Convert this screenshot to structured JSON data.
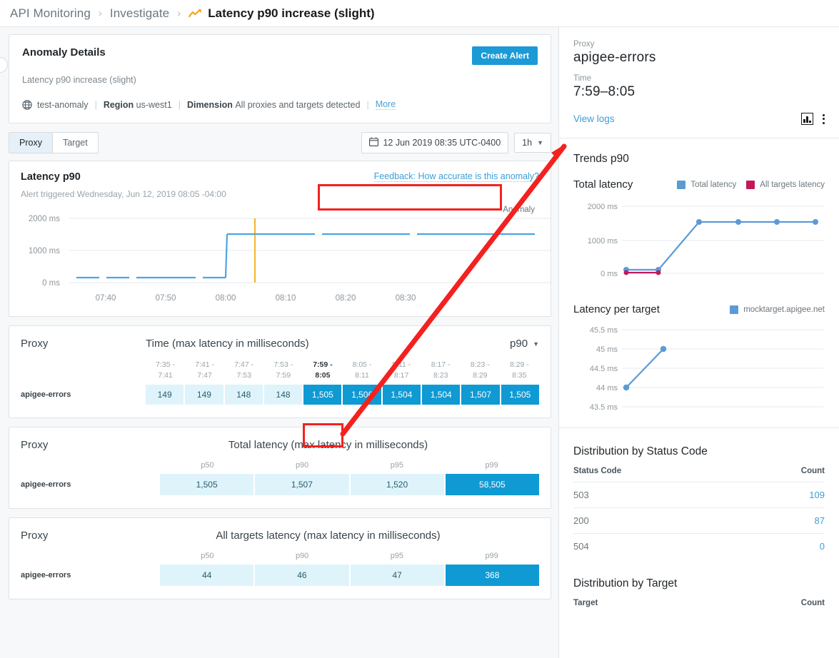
{
  "breadcrumb": {
    "root": "API Monitoring",
    "section": "Investigate",
    "icon": "trending-up-icon",
    "current": "Latency p90 increase (slight)",
    "separator": "›"
  },
  "anomaly": {
    "title": "Anomaly Details",
    "create_alert_label": "Create Alert",
    "subtitle": "Latency p90 increase (slight)",
    "env_name": "test-anomaly",
    "region_label": "Region",
    "region_value": "us-west1",
    "dimension_label": "Dimension",
    "dimension_value": "All proxies and targets detected",
    "more_label": "More",
    "separator": "|"
  },
  "toolbar": {
    "tabs": [
      {
        "label": "Proxy",
        "active": true
      },
      {
        "label": "Target",
        "active": false
      }
    ],
    "date_value": "12 Jun 2019 08:35 UTC-0400",
    "range_value": "1h",
    "calendar_icon": "calendar-icon",
    "caret_icon": "chevron-down-icon"
  },
  "latency_chart": {
    "title": "Latency p90",
    "feedback_label": "Feedback: How accurate is this anomaly?",
    "alert_text": "Alert triggered Wednesday, Jun 12, 2019 08:05 -04:00",
    "legend_label": "Anomaly"
  },
  "proxy_time_table": {
    "col_label": "Proxy",
    "title": "Time (max latency in milliseconds)",
    "percentile_label": "p90",
    "row_label": "apigee-errors",
    "buckets": [
      {
        "from": "7:35 -",
        "to": "7:41",
        "value": "149",
        "level": "light",
        "highlight": false
      },
      {
        "from": "7:41 -",
        "to": "7:47",
        "value": "149",
        "level": "light",
        "highlight": false
      },
      {
        "from": "7:47 -",
        "to": "7:53",
        "value": "148",
        "level": "light",
        "highlight": false
      },
      {
        "from": "7:53 -",
        "to": "7:59",
        "value": "148",
        "level": "light",
        "highlight": false
      },
      {
        "from": "7:59 -",
        "to": "8:05",
        "value": "1,505",
        "level": "dark",
        "highlight": true
      },
      {
        "from": "8:05 -",
        "to": "8:11",
        "value": "1,506",
        "level": "dark",
        "highlight": false
      },
      {
        "from": "8:11 -",
        "to": "8:17",
        "value": "1,504",
        "level": "dark",
        "highlight": false
      },
      {
        "from": "8:17 -",
        "to": "8:23",
        "value": "1,504",
        "level": "dark",
        "highlight": false
      },
      {
        "from": "8:23 -",
        "to": "8:29",
        "value": "1,507",
        "level": "dark",
        "highlight": false
      },
      {
        "from": "8:29 -",
        "to": "8:35",
        "value": "1,505",
        "level": "dark",
        "highlight": false
      }
    ]
  },
  "total_latency_table": {
    "col_label": "Proxy",
    "title": "Total latency (max latency in milliseconds)",
    "row_label": "apigee-errors",
    "headers": [
      "p50",
      "p90",
      "p95",
      "p99"
    ],
    "values": [
      "1,505",
      "1,507",
      "1,520",
      "58,505"
    ],
    "levels": [
      "light",
      "light",
      "light",
      "dark"
    ]
  },
  "all_targets_table": {
    "col_label": "Proxy",
    "title": "All targets latency (max latency in milliseconds)",
    "row_label": "apigee-errors",
    "headers": [
      "p50",
      "p90",
      "p95",
      "p99"
    ],
    "values": [
      "44",
      "46",
      "47",
      "368"
    ],
    "levels": [
      "light",
      "light",
      "light",
      "dark"
    ]
  },
  "sidebar": {
    "proxy_label": "Proxy",
    "proxy_value": "apigee-errors",
    "time_label": "Time",
    "time_value": "7:59–8:05",
    "view_logs_label": "View logs",
    "chart_icon": "bar-chart-icon",
    "kebab_icon": "more-vertical-icon",
    "trends_title": "Trends p90",
    "total_latency_title": "Total latency",
    "latency_per_target_title": "Latency per target",
    "distribution_status_title": "Distribution by Status Code",
    "status_headers": [
      "Status Code",
      "Count"
    ],
    "status_rows": [
      {
        "code": "503",
        "count": "109"
      },
      {
        "code": "200",
        "count": "87"
      },
      {
        "code": "504",
        "count": "0"
      }
    ],
    "distribution_target_title": "Distribution by Target",
    "target_headers": [
      "Target",
      "Count"
    ]
  },
  "colors": {
    "accent_blue": "#1b9ad6",
    "link_blue": "#3d9ed6",
    "cell_dark": "#0f9ad4",
    "cell_light": "#def4fa",
    "anomaly_orange": "#f6b52a",
    "series_blue": "#5b9bd5",
    "series_magenta": "#c2185b",
    "annotation_red": "#f4211f"
  },
  "chart_data": [
    {
      "id": "latency-p90-main",
      "type": "line",
      "title": "Latency p90",
      "xlabel": "",
      "ylabel": "",
      "ylim": [
        0,
        2400
      ],
      "yticks": [
        0,
        1000,
        2000
      ],
      "ytick_labels": [
        "0 ms",
        "1000 ms",
        "2000 ms"
      ],
      "xticks": [
        "07:40",
        "07:50",
        "08:00",
        "08:10",
        "08:20",
        "08:30"
      ],
      "grid": true,
      "legend": [
        "Anomaly"
      ],
      "legend_position": "top-right",
      "annotations": [
        {
          "type": "vline",
          "label": "Anomaly",
          "x": "08:05",
          "color": "#f6b52a"
        }
      ],
      "series": [
        {
          "name": "Latency p90",
          "color": "#4da6de",
          "x": [
            "07:35",
            "07:41",
            "07:47",
            "07:53",
            "07:59",
            "08:05",
            "08:11",
            "08:17",
            "08:23",
            "08:29",
            "08:35"
          ],
          "values": [
            149,
            149,
            148,
            148,
            1505,
            1506,
            1504,
            1504,
            1507,
            1505,
            1505
          ]
        }
      ]
    },
    {
      "id": "trends-total-latency",
      "type": "line",
      "title": "Total latency",
      "ylim": [
        0,
        2400
      ],
      "yticks": [
        0,
        1000,
        2000
      ],
      "ytick_labels": [
        "0 ms",
        "1000 ms",
        "2000 ms"
      ],
      "grid": true,
      "legend": [
        "Total latency",
        "All targets latency"
      ],
      "legend_position": "top-right",
      "series": [
        {
          "name": "Total latency",
          "color": "#5b9bd5",
          "values": [
            150,
            150,
            1505,
            1506,
            1504,
            1505
          ]
        },
        {
          "name": "All targets latency",
          "color": "#c2185b",
          "values": [
            44,
            45
          ]
        }
      ]
    },
    {
      "id": "latency-per-target",
      "type": "line",
      "title": "Latency per target",
      "ylim": [
        43.5,
        45.5
      ],
      "yticks": [
        43.5,
        44,
        44.5,
        45,
        45.5
      ],
      "ytick_labels": [
        "43.5 ms",
        "44 ms",
        "44.5 ms",
        "45 ms",
        "45.5 ms"
      ],
      "grid": true,
      "legend": [
        "mocktarget.apigee.net"
      ],
      "legend_position": "top-right",
      "series": [
        {
          "name": "mocktarget.apigee.net",
          "color": "#5b9bd5",
          "values": [
            44,
            45
          ]
        }
      ]
    }
  ]
}
